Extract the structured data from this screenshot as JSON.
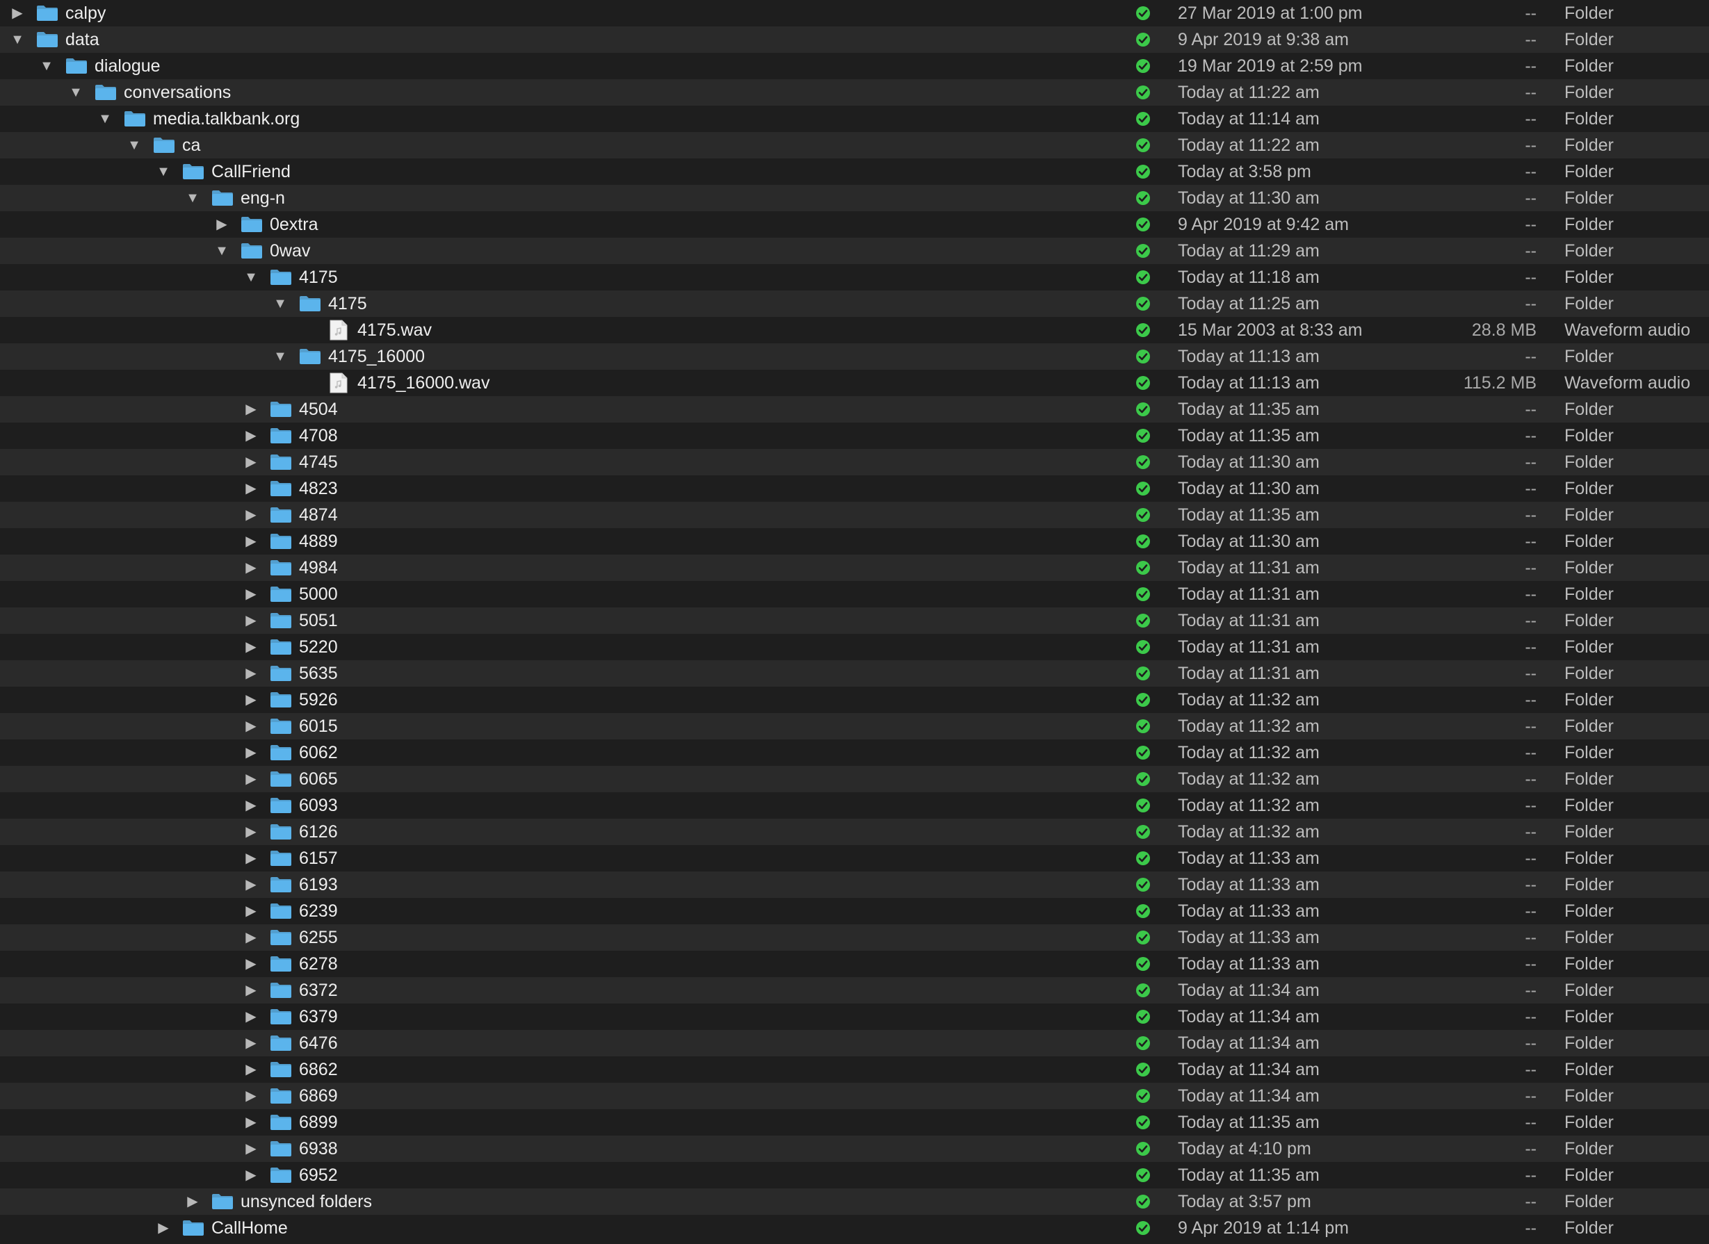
{
  "colors": {
    "background": "#1e1e1e",
    "row_alternate": "#2a2a2a",
    "folder_blue": "#5bb4ec",
    "sync_green": "#3cc94a"
  },
  "icons": {
    "expanded": "▼",
    "collapsed": "▶",
    "folder": "folder-icon",
    "file": "audio-file-icon",
    "sync": "synced-checkmark-icon"
  },
  "rows": [
    {
      "name": "calpy",
      "level": 0,
      "state": "collapsed",
      "type": "folder",
      "date": "27 Mar 2019 at 1:00 pm",
      "size": "--",
      "kind": "Folder"
    },
    {
      "name": "data",
      "level": 0,
      "state": "expanded",
      "type": "folder",
      "date": "9 Apr 2019 at 9:38 am",
      "size": "--",
      "kind": "Folder"
    },
    {
      "name": "dialogue",
      "level": 1,
      "state": "expanded",
      "type": "folder",
      "date": "19 Mar 2019 at 2:59 pm",
      "size": "--",
      "kind": "Folder"
    },
    {
      "name": "conversations",
      "level": 2,
      "state": "expanded",
      "type": "folder",
      "date": "Today at 11:22 am",
      "size": "--",
      "kind": "Folder"
    },
    {
      "name": "media.talkbank.org",
      "level": 3,
      "state": "expanded",
      "type": "folder",
      "date": "Today at 11:14 am",
      "size": "--",
      "kind": "Folder"
    },
    {
      "name": "ca",
      "level": 4,
      "state": "expanded",
      "type": "folder",
      "date": "Today at 11:22 am",
      "size": "--",
      "kind": "Folder"
    },
    {
      "name": "CallFriend",
      "level": 5,
      "state": "expanded",
      "type": "folder",
      "date": "Today at 3:58 pm",
      "size": "--",
      "kind": "Folder"
    },
    {
      "name": "eng-n",
      "level": 6,
      "state": "expanded",
      "type": "folder",
      "date": "Today at 11:30 am",
      "size": "--",
      "kind": "Folder"
    },
    {
      "name": "0extra",
      "level": 7,
      "state": "collapsed",
      "type": "folder",
      "date": "9 Apr 2019 at 9:42 am",
      "size": "--",
      "kind": "Folder"
    },
    {
      "name": "0wav",
      "level": 7,
      "state": "expanded",
      "type": "folder",
      "date": "Today at 11:29 am",
      "size": "--",
      "kind": "Folder"
    },
    {
      "name": "4175",
      "level": 8,
      "state": "expanded",
      "type": "folder",
      "date": "Today at 11:18 am",
      "size": "--",
      "kind": "Folder"
    },
    {
      "name": "4175",
      "level": 9,
      "state": "expanded",
      "type": "folder",
      "date": "Today at 11:25 am",
      "size": "--",
      "kind": "Folder"
    },
    {
      "name": "4175.wav",
      "level": 10,
      "state": "none",
      "type": "file",
      "date": "15 Mar 2003 at 8:33 am",
      "size": "28.8 MB",
      "kind": "Waveform audio"
    },
    {
      "name": "4175_16000",
      "level": 9,
      "state": "expanded",
      "type": "folder",
      "date": "Today at 11:13 am",
      "size": "--",
      "kind": "Folder"
    },
    {
      "name": "4175_16000.wav",
      "level": 10,
      "state": "none",
      "type": "file",
      "date": "Today at 11:13 am",
      "size": "115.2 MB",
      "kind": "Waveform audio"
    },
    {
      "name": "4504",
      "level": 8,
      "state": "collapsed",
      "type": "folder",
      "date": "Today at 11:35 am",
      "size": "--",
      "kind": "Folder"
    },
    {
      "name": "4708",
      "level": 8,
      "state": "collapsed",
      "type": "folder",
      "date": "Today at 11:35 am",
      "size": "--",
      "kind": "Folder"
    },
    {
      "name": "4745",
      "level": 8,
      "state": "collapsed",
      "type": "folder",
      "date": "Today at 11:30 am",
      "size": "--",
      "kind": "Folder"
    },
    {
      "name": "4823",
      "level": 8,
      "state": "collapsed",
      "type": "folder",
      "date": "Today at 11:30 am",
      "size": "--",
      "kind": "Folder"
    },
    {
      "name": "4874",
      "level": 8,
      "state": "collapsed",
      "type": "folder",
      "date": "Today at 11:35 am",
      "size": "--",
      "kind": "Folder"
    },
    {
      "name": "4889",
      "level": 8,
      "state": "collapsed",
      "type": "folder",
      "date": "Today at 11:30 am",
      "size": "--",
      "kind": "Folder"
    },
    {
      "name": "4984",
      "level": 8,
      "state": "collapsed",
      "type": "folder",
      "date": "Today at 11:31 am",
      "size": "--",
      "kind": "Folder"
    },
    {
      "name": "5000",
      "level": 8,
      "state": "collapsed",
      "type": "folder",
      "date": "Today at 11:31 am",
      "size": "--",
      "kind": "Folder"
    },
    {
      "name": "5051",
      "level": 8,
      "state": "collapsed",
      "type": "folder",
      "date": "Today at 11:31 am",
      "size": "--",
      "kind": "Folder"
    },
    {
      "name": "5220",
      "level": 8,
      "state": "collapsed",
      "type": "folder",
      "date": "Today at 11:31 am",
      "size": "--",
      "kind": "Folder"
    },
    {
      "name": "5635",
      "level": 8,
      "state": "collapsed",
      "type": "folder",
      "date": "Today at 11:31 am",
      "size": "--",
      "kind": "Folder"
    },
    {
      "name": "5926",
      "level": 8,
      "state": "collapsed",
      "type": "folder",
      "date": "Today at 11:32 am",
      "size": "--",
      "kind": "Folder"
    },
    {
      "name": "6015",
      "level": 8,
      "state": "collapsed",
      "type": "folder",
      "date": "Today at 11:32 am",
      "size": "--",
      "kind": "Folder"
    },
    {
      "name": "6062",
      "level": 8,
      "state": "collapsed",
      "type": "folder",
      "date": "Today at 11:32 am",
      "size": "--",
      "kind": "Folder"
    },
    {
      "name": "6065",
      "level": 8,
      "state": "collapsed",
      "type": "folder",
      "date": "Today at 11:32 am",
      "size": "--",
      "kind": "Folder"
    },
    {
      "name": "6093",
      "level": 8,
      "state": "collapsed",
      "type": "folder",
      "date": "Today at 11:32 am",
      "size": "--",
      "kind": "Folder"
    },
    {
      "name": "6126",
      "level": 8,
      "state": "collapsed",
      "type": "folder",
      "date": "Today at 11:32 am",
      "size": "--",
      "kind": "Folder"
    },
    {
      "name": "6157",
      "level": 8,
      "state": "collapsed",
      "type": "folder",
      "date": "Today at 11:33 am",
      "size": "--",
      "kind": "Folder"
    },
    {
      "name": "6193",
      "level": 8,
      "state": "collapsed",
      "type": "folder",
      "date": "Today at 11:33 am",
      "size": "--",
      "kind": "Folder"
    },
    {
      "name": "6239",
      "level": 8,
      "state": "collapsed",
      "type": "folder",
      "date": "Today at 11:33 am",
      "size": "--",
      "kind": "Folder"
    },
    {
      "name": "6255",
      "level": 8,
      "state": "collapsed",
      "type": "folder",
      "date": "Today at 11:33 am",
      "size": "--",
      "kind": "Folder"
    },
    {
      "name": "6278",
      "level": 8,
      "state": "collapsed",
      "type": "folder",
      "date": "Today at 11:33 am",
      "size": "--",
      "kind": "Folder"
    },
    {
      "name": "6372",
      "level": 8,
      "state": "collapsed",
      "type": "folder",
      "date": "Today at 11:34 am",
      "size": "--",
      "kind": "Folder"
    },
    {
      "name": "6379",
      "level": 8,
      "state": "collapsed",
      "type": "folder",
      "date": "Today at 11:34 am",
      "size": "--",
      "kind": "Folder"
    },
    {
      "name": "6476",
      "level": 8,
      "state": "collapsed",
      "type": "folder",
      "date": "Today at 11:34 am",
      "size": "--",
      "kind": "Folder"
    },
    {
      "name": "6862",
      "level": 8,
      "state": "collapsed",
      "type": "folder",
      "date": "Today at 11:34 am",
      "size": "--",
      "kind": "Folder"
    },
    {
      "name": "6869",
      "level": 8,
      "state": "collapsed",
      "type": "folder",
      "date": "Today at 11:34 am",
      "size": "--",
      "kind": "Folder"
    },
    {
      "name": "6899",
      "level": 8,
      "state": "collapsed",
      "type": "folder",
      "date": "Today at 11:35 am",
      "size": "--",
      "kind": "Folder"
    },
    {
      "name": "6938",
      "level": 8,
      "state": "collapsed",
      "type": "folder",
      "date": "Today at 4:10 pm",
      "size": "--",
      "kind": "Folder"
    },
    {
      "name": "6952",
      "level": 8,
      "state": "collapsed",
      "type": "folder",
      "date": "Today at 11:35 am",
      "size": "--",
      "kind": "Folder"
    },
    {
      "name": "unsynced folders",
      "level": 6,
      "state": "collapsed",
      "type": "folder",
      "date": "Today at 3:57 pm",
      "size": "--",
      "kind": "Folder"
    },
    {
      "name": "CallHome",
      "level": 5,
      "state": "collapsed",
      "type": "folder",
      "date": "9 Apr 2019 at 1:14 pm",
      "size": "--",
      "kind": "Folder"
    }
  ]
}
